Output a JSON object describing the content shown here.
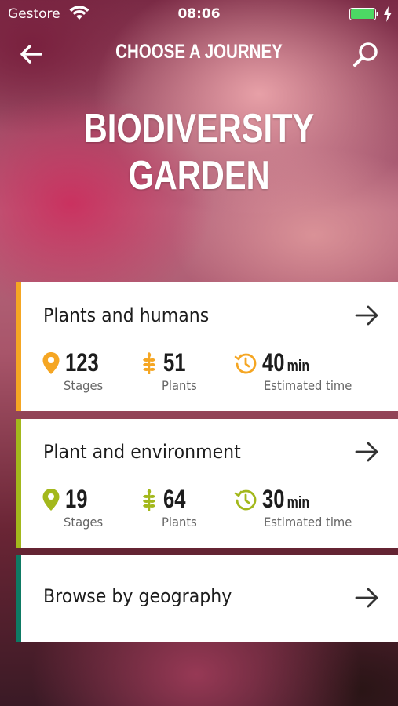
{
  "status_bar": {
    "carrier": "Gestore",
    "time": "08:06"
  },
  "nav": {
    "title": "CHOOSE A JOURNEY"
  },
  "hero": {
    "title": "BIODIVERSITY GARDEN"
  },
  "journeys": [
    {
      "title": "Plants and humans",
      "accent": "#f5a623",
      "stages": {
        "value": "123",
        "label": "Stages"
      },
      "plants": {
        "value": "51",
        "label": "Plants"
      },
      "time": {
        "value": "40",
        "unit": "min",
        "label": "Estimated time"
      }
    },
    {
      "title": "Plant and environment",
      "accent": "#a3b81c",
      "stages": {
        "value": "19",
        "label": "Stages"
      },
      "plants": {
        "value": "64",
        "label": "Plants"
      },
      "time": {
        "value": "30",
        "unit": "min",
        "label": "Estimated time"
      }
    },
    {
      "title": "Browse by geography",
      "accent": "#0e7a64"
    }
  ],
  "icons": {
    "back": "arrow-left-icon",
    "search": "search-icon",
    "arrow": "arrow-right-icon",
    "stages": "map-pin-icon",
    "plants": "wheat-icon",
    "time": "clock-icon"
  },
  "battery": {
    "color": "#4cd964",
    "level": 1.0
  }
}
